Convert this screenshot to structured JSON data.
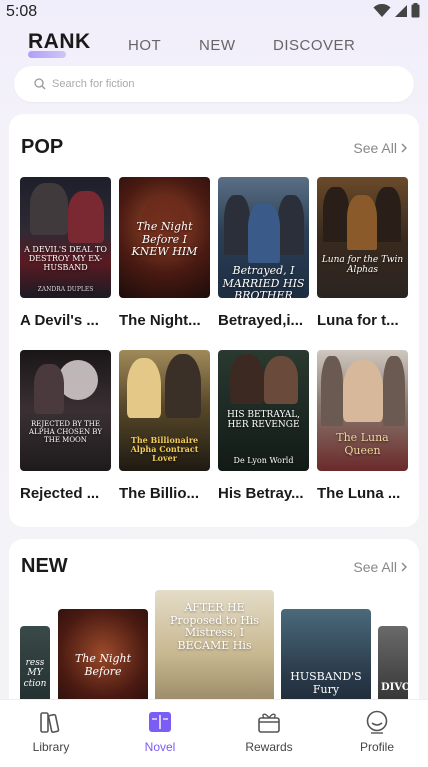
{
  "status": {
    "time": "5:08"
  },
  "tabs": [
    {
      "label": "RANK"
    },
    {
      "label": "HOT"
    },
    {
      "label": "NEW"
    },
    {
      "label": "DISCOVER"
    }
  ],
  "search": {
    "placeholder": "Search for fiction"
  },
  "pop": {
    "title": "POP",
    "see_all": "See All",
    "books": [
      {
        "name": "A Devil's ...",
        "cover_text": "A DEVIL'S DEAL TO DESTROY MY EX-HUSBAND",
        "author": "ZANDRA DUPLES"
      },
      {
        "name": "The Night...",
        "cover_text": "The Night Before I KNEW HIM"
      },
      {
        "name": "Betrayed,i...",
        "cover_text": "Betrayed, I MARRIED HIS BROTHER"
      },
      {
        "name": "Luna for t...",
        "cover_text": "Luna for the Twin Alphas"
      },
      {
        "name": "Rejected ...",
        "cover_text": "REJECTED BY THE ALPHA CHOSEN BY THE MOON"
      },
      {
        "name": "The Billio...",
        "cover_text": "The Billionaire Alpha Contract Lover"
      },
      {
        "name": "His Betray...",
        "cover_text": "HIS BETRAYAL, HER REVENGE",
        "author": "De Lyon World"
      },
      {
        "name": "The Luna ...",
        "cover_text": "The Luna Queen"
      }
    ]
  },
  "new": {
    "title": "NEW",
    "see_all": "See All",
    "books": [
      {
        "cover_text": "ress MY ction"
      },
      {
        "cover_text": "The Night Before"
      },
      {
        "cover_text": "AFTER HE Proposed to His Mistress, I BECAME His"
      },
      {
        "cover_text": "HUSBAND'S Fury"
      },
      {
        "cover_text": "DIVO"
      }
    ]
  },
  "nav": [
    {
      "label": "Library",
      "icon": "library-icon"
    },
    {
      "label": "Novel",
      "icon": "novel-icon"
    },
    {
      "label": "Rewards",
      "icon": "rewards-icon"
    },
    {
      "label": "Profile",
      "icon": "profile-icon"
    }
  ],
  "colors": {
    "accent": "#7b5cf5"
  }
}
